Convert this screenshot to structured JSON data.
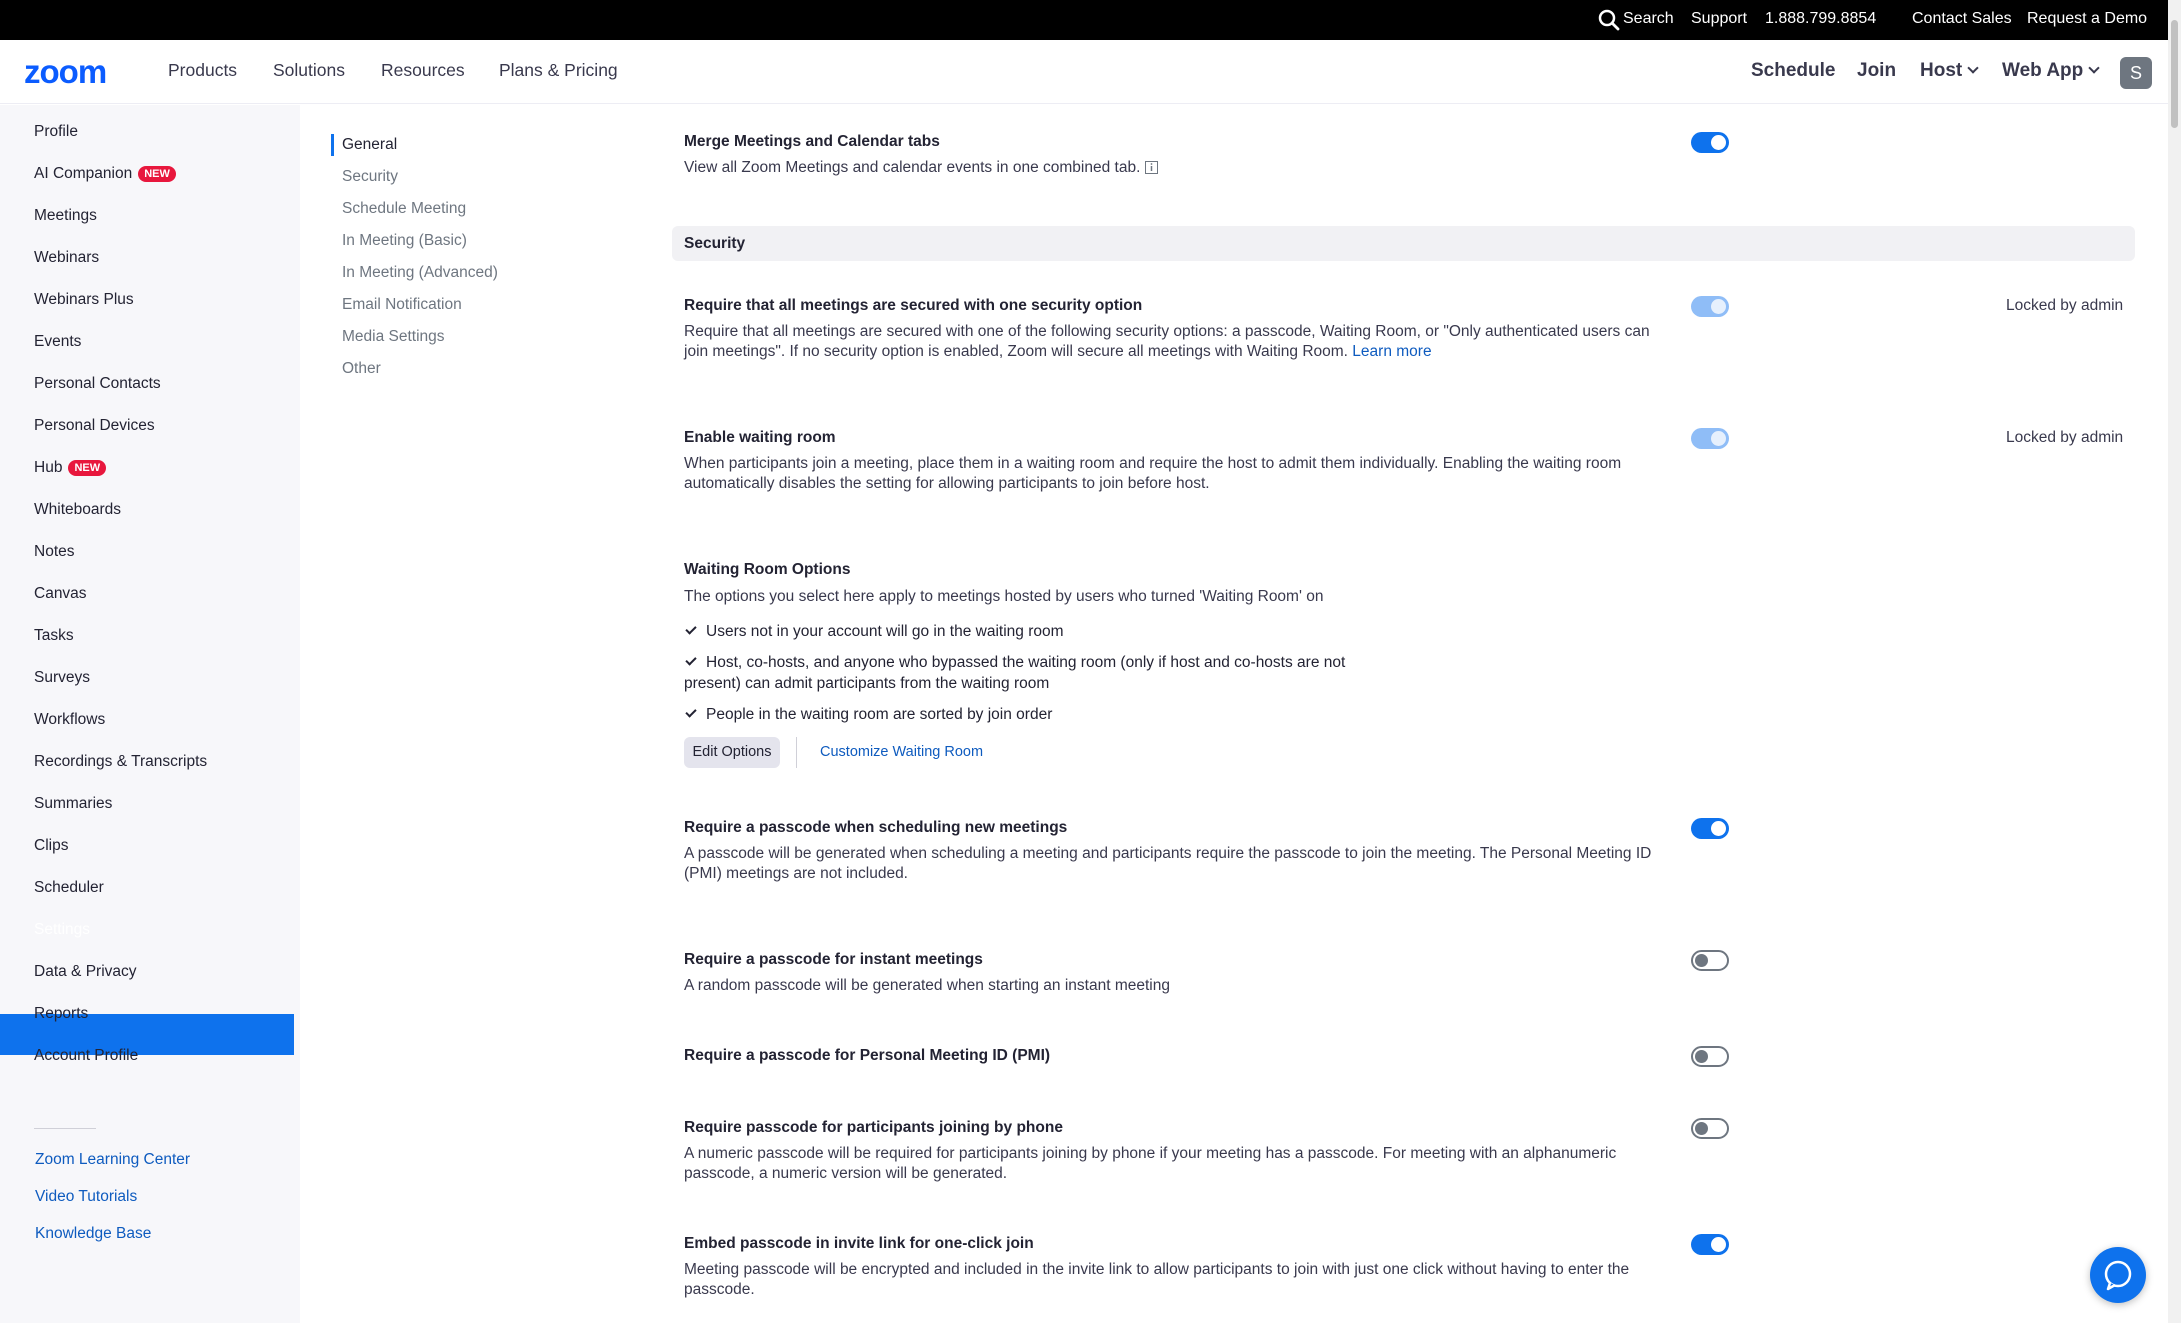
{
  "topbar": {
    "search": "Search",
    "support": "Support",
    "phone": "1.888.799.8854",
    "contact_sales": "Contact Sales",
    "request_demo": "Request a Demo"
  },
  "nav": {
    "logo": "zoom",
    "products": "Products",
    "solutions": "Solutions",
    "resources": "Resources",
    "plans": "Plans & Pricing",
    "schedule": "Schedule",
    "join": "Join",
    "host": "Host",
    "web_app": "Web App",
    "avatar_initial": "S"
  },
  "sidebar": {
    "items": [
      {
        "label": "Profile"
      },
      {
        "label": "AI Companion",
        "badge": "NEW"
      },
      {
        "label": "Meetings"
      },
      {
        "label": "Webinars"
      },
      {
        "label": "Webinars Plus"
      },
      {
        "label": "Events"
      },
      {
        "label": "Personal Contacts"
      },
      {
        "label": "Personal Devices"
      },
      {
        "label": "Hub",
        "badge": "NEW"
      },
      {
        "label": "Whiteboards"
      },
      {
        "label": "Notes"
      },
      {
        "label": "Canvas"
      },
      {
        "label": "Tasks"
      },
      {
        "label": "Surveys"
      },
      {
        "label": "Workflows"
      },
      {
        "label": "Recordings & Transcripts"
      },
      {
        "label": "Summaries"
      },
      {
        "label": "Clips"
      },
      {
        "label": "Scheduler"
      },
      {
        "label": "Settings",
        "active": true
      },
      {
        "label": "Data & Privacy"
      },
      {
        "label": "Reports"
      },
      {
        "label": "Account Profile"
      }
    ],
    "links": [
      "Zoom Learning Center",
      "Video Tutorials",
      "Knowledge Base"
    ]
  },
  "submenu": [
    "General",
    "Security",
    "Schedule Meeting",
    "In Meeting (Basic)",
    "In Meeting (Advanced)",
    "Email Notification",
    "Media Settings",
    "Other"
  ],
  "content": {
    "merge_title": "Merge Meetings and Calendar tabs",
    "merge_desc": "View all Zoom Meetings and calendar events in one combined tab.",
    "section": "Security",
    "locked_label": "Locked by admin",
    "s1_title": "Require that all meetings are secured with one security option",
    "s1_desc": "Require that all meetings are secured with one of the following security options: a passcode, Waiting Room, or \"Only authenticated users can join meetings\". If no security option is enabled, Zoom will secure all meetings with Waiting Room.",
    "s1_link": "Learn more",
    "s2_title": "Enable waiting room",
    "s2_desc": "When participants join a meeting, place them in a waiting room and require the host to admit them individually. Enabling the waiting room automatically disables the setting for allowing participants to join before host.",
    "wr_title": "Waiting Room Options",
    "wr_desc": "The options you select here apply to meetings hosted by users who turned 'Waiting Room' on",
    "wr_opt1": "Users not in your account will go in the waiting room",
    "wr_opt2": "Host, co-hosts, and anyone who bypassed the waiting room (only if host and co-hosts are not present) can admit participants from the waiting room",
    "wr_opt3": "People in the waiting room are sorted by join order",
    "edit_options": "Edit Options",
    "customize": "Customize Waiting Room",
    "s3_title": "Require a passcode when scheduling new meetings",
    "s3_desc": "A passcode will be generated when scheduling a meeting and participants require the passcode to join the meeting. The Personal Meeting ID (PMI) meetings are not included.",
    "s4_title": "Require a passcode for instant meetings",
    "s4_desc": "A random passcode will be generated when starting an instant meeting",
    "s5_title": "Require a passcode for Personal Meeting ID (PMI)",
    "s6_title": "Require passcode for participants joining by phone",
    "s6_desc": "A numeric passcode will be required for participants joining by phone if your meeting has a passcode. For meeting with an alphanumeric passcode, a numeric version will be generated.",
    "s7_title": "Embed passcode in invite link for one-click join",
    "s7_desc": "Meeting passcode will be encrypted and included in the invite link to allow participants to join with just one click without having to enter the passcode."
  },
  "toggles": {
    "merge": "on",
    "s1": "locked-on",
    "s2": "locked-on",
    "s3": "on",
    "s4": "off",
    "s5": "off",
    "s6": "off",
    "s7": "on"
  },
  "colors": {
    "accent": "#0e72ed",
    "badge": "#e8173d"
  }
}
